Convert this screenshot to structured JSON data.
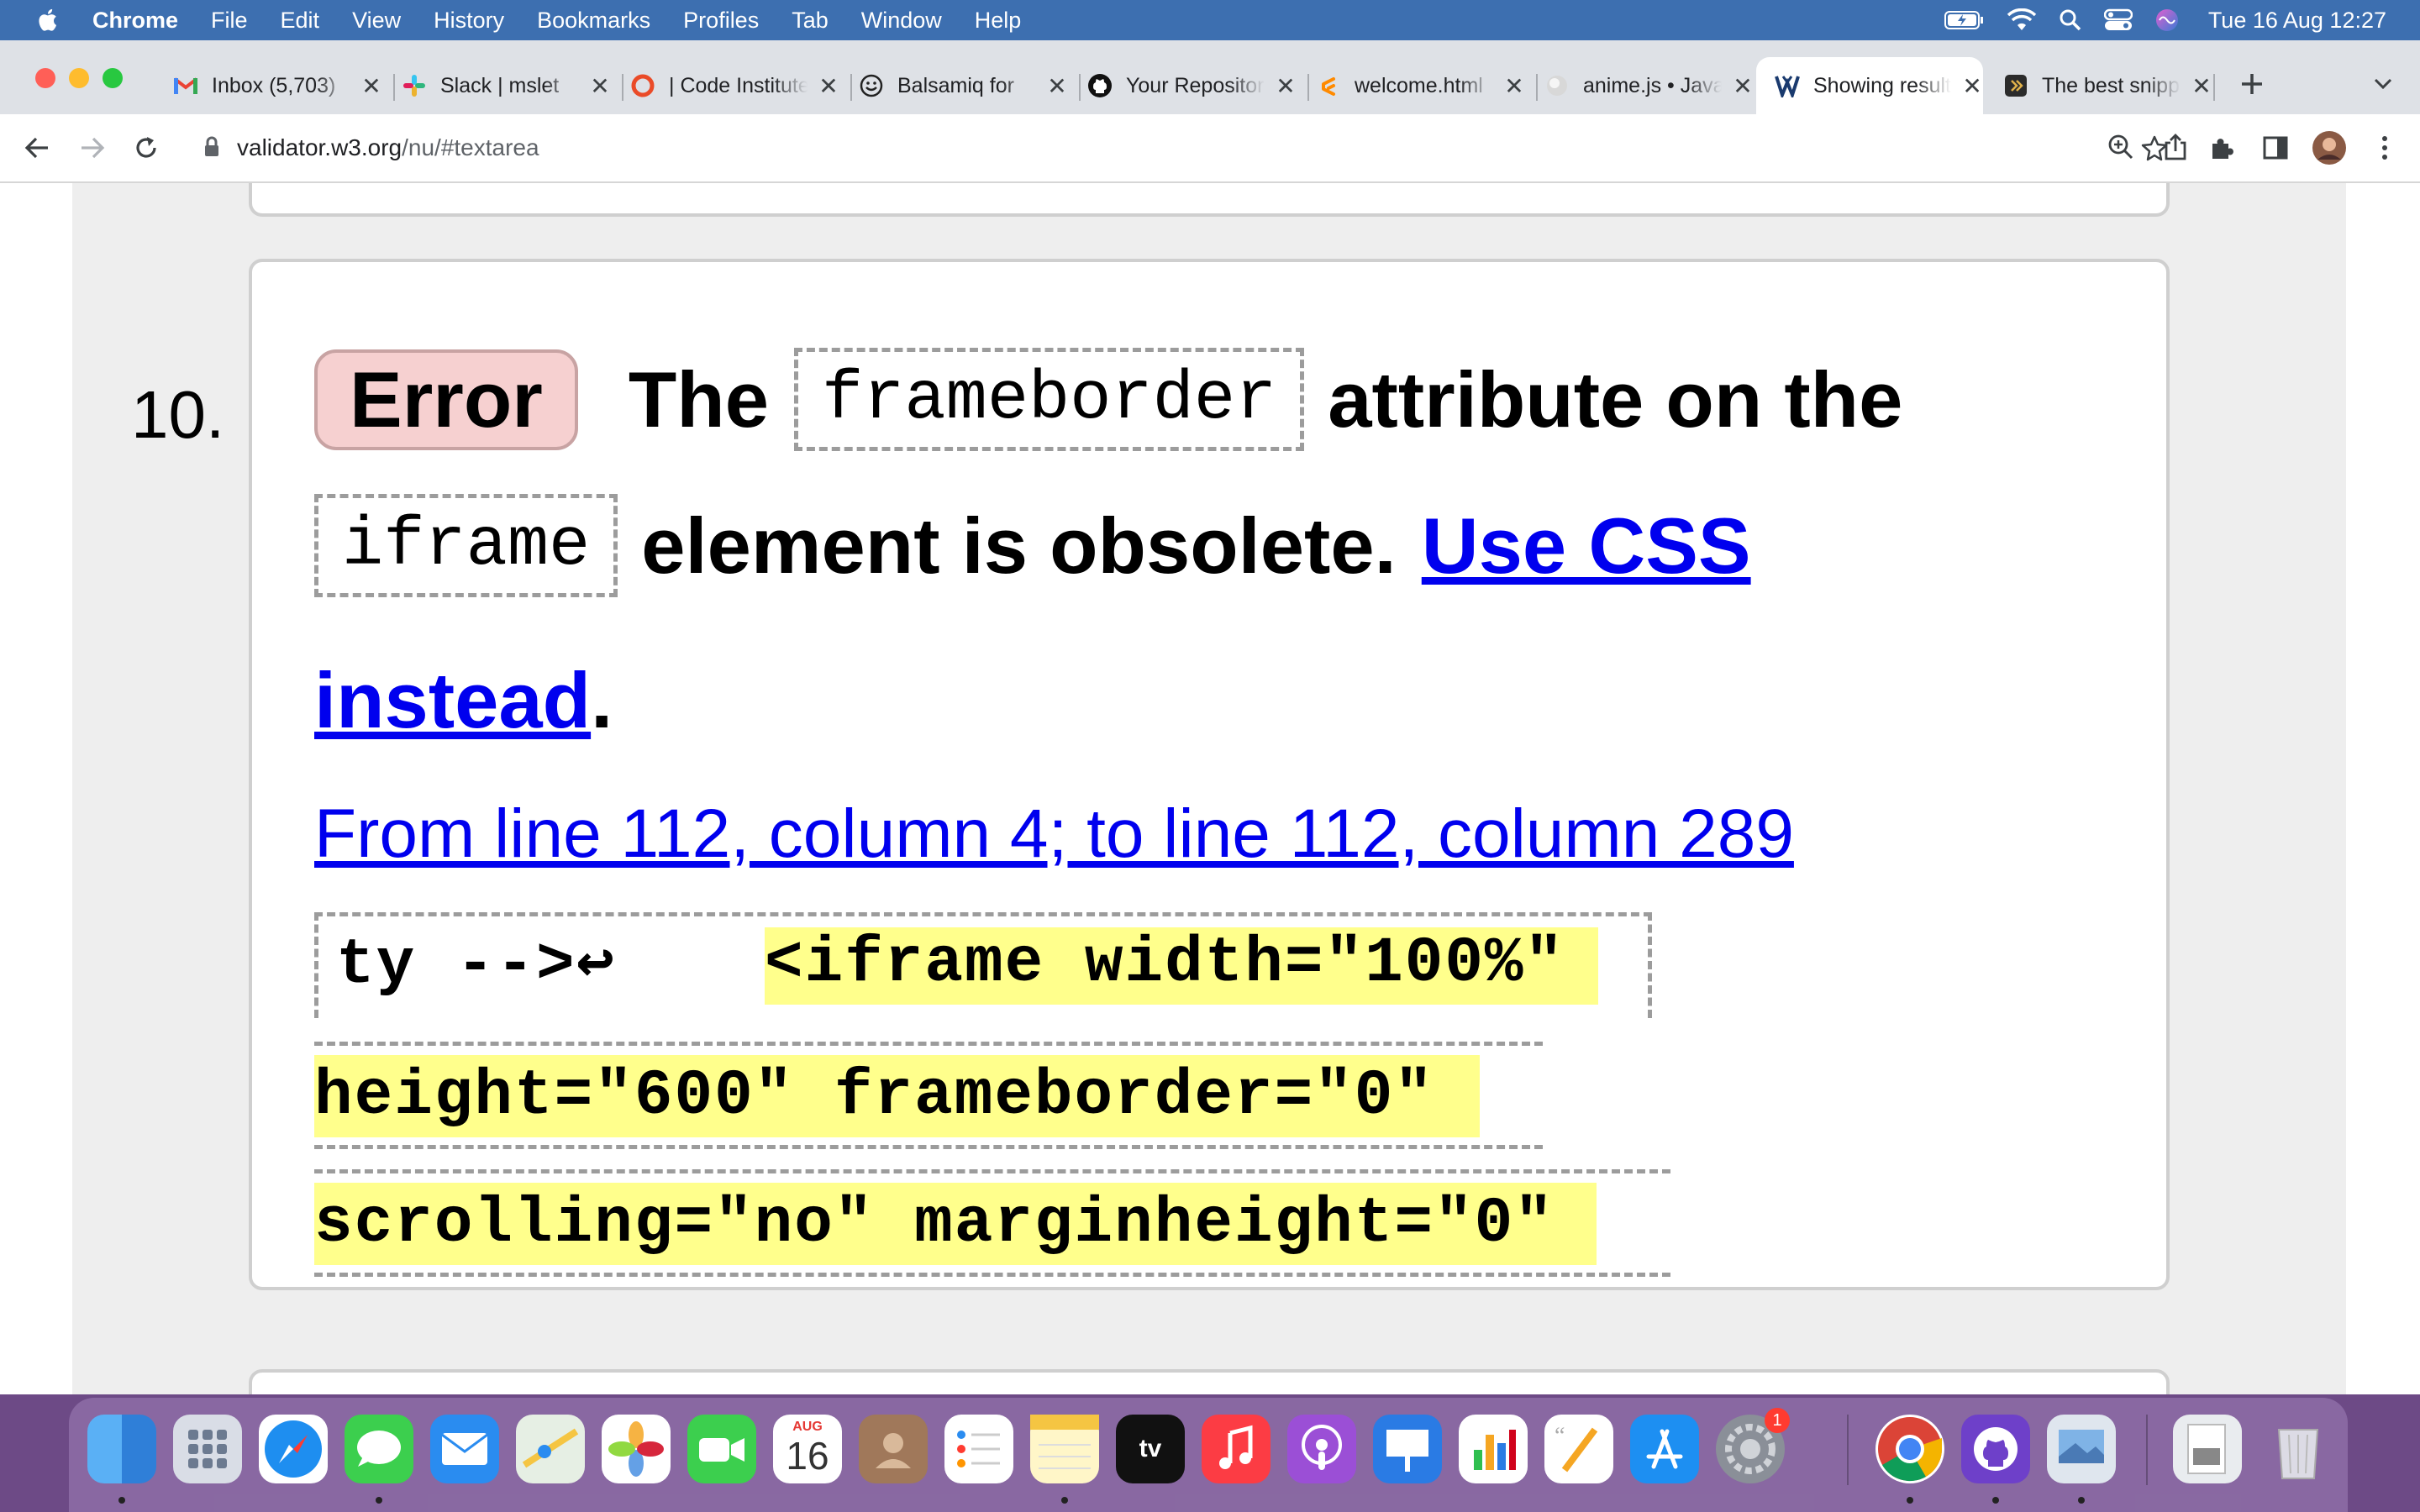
{
  "menubar": {
    "app": "Chrome",
    "items": [
      "File",
      "Edit",
      "View",
      "History",
      "Bookmarks",
      "Profiles",
      "Tab",
      "Window",
      "Help"
    ],
    "clock": "Tue 16 Aug  12:27"
  },
  "tabs": [
    {
      "title": "Inbox (5,703)",
      "icon": "gmail-icon"
    },
    {
      "title": "Slack | mslet",
      "icon": "slack-icon"
    },
    {
      "title": "| Code Institute",
      "icon": "code-institute-icon"
    },
    {
      "title": "Balsamiq for",
      "icon": "balsamiq-icon"
    },
    {
      "title": "Your Repositories",
      "icon": "github-icon"
    },
    {
      "title": "welcome.html",
      "icon": "gitpod-icon"
    },
    {
      "title": "anime.js • JavaScript",
      "icon": "anime-icon"
    },
    {
      "title": "Showing results",
      "icon": "w3c-validator-icon"
    },
    {
      "title": "The best snippets",
      "icon": "snippet-icon"
    }
  ],
  "address": {
    "host": "validator.w3.org",
    "path": "/nu/#textarea"
  },
  "message": {
    "number": "10.",
    "badge": "Error",
    "part1": "The",
    "code1": "frameborder",
    "part2": "attribute on the",
    "code2": "iframe",
    "part3": "element is obsolete.",
    "link_a": "Use CSS",
    "link_b": "instead",
    "period": ".",
    "location": "From line 112, column 4; to line 112, column 289",
    "extract_pre": "ty -->↩",
    "extract_line1": "<iframe width=\"100%\"",
    "extract_line2": "height=\"600\" frameborder=\"0\"",
    "extract_line3": "scrolling=\"no\" marginheight=\"0\""
  },
  "dock": {
    "calendar_month": "AUG",
    "calendar_day": "16",
    "tv_label": "tv",
    "settings_badge": "1"
  }
}
